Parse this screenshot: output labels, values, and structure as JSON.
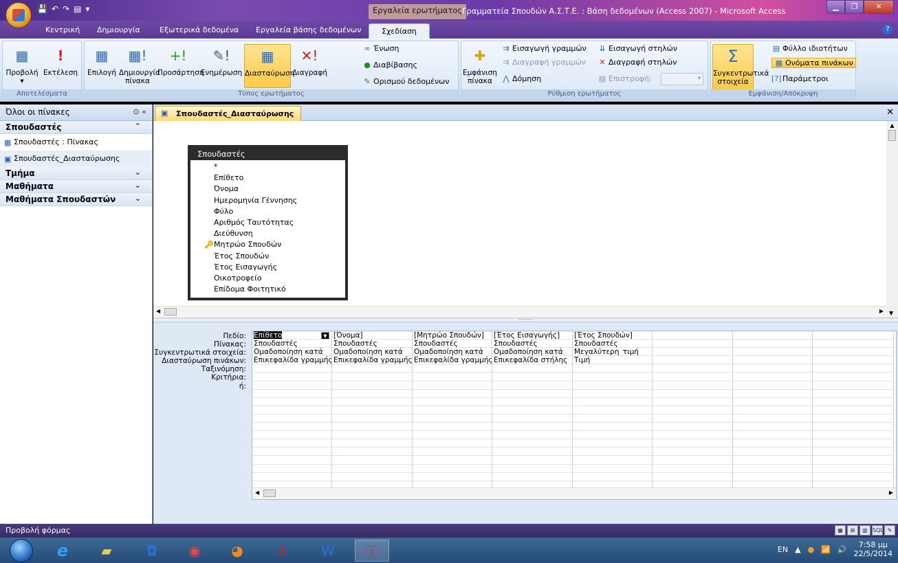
{
  "window": {
    "title": "Γραμματεία Σπουδών Α.Σ.Τ.Ε. : Βάση δεδομένων (Access 2007) - Microsoft Access",
    "context_tab": "Εργαλεία ερωτήματος",
    "qat_icons": [
      "save-icon",
      "undo-icon",
      "redo-icon",
      "view-icon",
      "customize-icon"
    ]
  },
  "tabs": [
    "Κεντρική",
    "Δημιουργία",
    "Εξωτερικά δεδομένα",
    "Εργαλεία βάσης δεδομένων",
    "Σχεδίαση"
  ],
  "ribbon": {
    "results": {
      "caption": "Αποτελέσματα",
      "view": "Προβολή",
      "run": "Εκτέλεση"
    },
    "query_type": {
      "caption": "Τύπος ερωτήματος",
      "select": "Επιλογή",
      "make_table": "Δημιουργία πίνακα",
      "append": "Προσάρτηση",
      "update": "Ενημέρωση",
      "crosstab": "Διασταύρωση",
      "delete": "Διαγραφή",
      "union": "Ένωση",
      "pass_through": "Διαβίβασης",
      "data_definition": "Ορισμού δεδομένων"
    },
    "query_setup": {
      "caption": "Ρύθμιση ερωτήματος",
      "show_table": "Εμφάνιση πίνακα",
      "insert_rows": "Εισαγωγή γραμμών",
      "delete_rows": "Διαγραφή γραμμών",
      "builder": "Δόμηση",
      "insert_columns": "Εισαγωγή στηλών",
      "delete_columns": "Διαγραφή στηλών",
      "return": "Επιστροφή:"
    },
    "show_hide": {
      "caption": "Εμφάνιση/Απόκρυψη",
      "totals": "Συγκεντρωτικά στοιχεία",
      "property_sheet": "Φύλλο ιδιοτήτων",
      "table_names": "Ονόματα πινάκων",
      "parameters": "Παράμετροι"
    }
  },
  "nav": {
    "header": "Όλοι οι πίνακες",
    "groups": [
      {
        "name": "Σπουδαστές",
        "expanded": true,
        "items": [
          {
            "label": "Σπουδαστές : Πίνακας",
            "icon": "table-icon"
          },
          {
            "label": "Σπουδαστές_Διασταύρωσης",
            "icon": "query-icon"
          }
        ]
      },
      {
        "name": "Τμήμα",
        "expanded": false,
        "items": []
      },
      {
        "name": "Μαθήματα",
        "expanded": false,
        "items": []
      },
      {
        "name": "Μαθήματα Σπουδαστών",
        "expanded": false,
        "items": []
      }
    ]
  },
  "document": {
    "tab_title": "Σπουδαστές_Διασταύρωσης",
    "table_box": {
      "name": "Σπουδαστές",
      "fields": [
        "*",
        "Επίθετο",
        "Όνομα",
        "Ημερομηνία Γέννησης",
        "Φύλο",
        "Αριθμός Ταυτότητας",
        "Διεύθυνση",
        "Μητρώο Σπουδών",
        "Έτος Σπουδών",
        "Έτος Εισαγωγής",
        "Οικοτροφείο",
        "Επίδομα Φοιτητικό"
      ],
      "key_field_index": 7
    },
    "grid_row_labels": [
      "Πεδίο:",
      "Πίνακας:",
      "Συγκεντρωτικά στοιχεία:",
      "Διασταύρωση πινάκων:",
      "Ταξινόμηση:",
      "Κριτήρια:",
      "ή:"
    ],
    "grid_columns": [
      {
        "field": "Επίθετο",
        "table": "Σπουδαστές",
        "total": "Ομαδοποίηση κατά",
        "crosstab": "Επικεφαλίδα γραμμής"
      },
      {
        "field": "[Όνομα]",
        "table": "Σπουδαστές",
        "total": "Ομαδοποίηση κατά",
        "crosstab": "Επικεφαλίδα γραμμής"
      },
      {
        "field": "[Μητρώο Σπουδών]",
        "table": "Σπουδαστές",
        "total": "Ομαδοποίηση κατά",
        "crosstab": "Επικεφαλίδα γραμμής"
      },
      {
        "field": "[Έτος Εισαγωγής]",
        "table": "Σπουδαστές",
        "total": "Ομαδοποίηση κατά",
        "crosstab": "Επικεφαλίδα στήλης"
      },
      {
        "field": "[Έτος Σπουδών]",
        "table": "Σπουδαστές",
        "total": "Μεγαλύτερη_τιμή",
        "crosstab": "Τιμή"
      },
      {
        "field": "",
        "table": "",
        "total": "",
        "crosstab": ""
      },
      {
        "field": "",
        "table": "",
        "total": "",
        "crosstab": ""
      },
      {
        "field": "",
        "table": "",
        "total": "",
        "crosstab": ""
      }
    ]
  },
  "status": {
    "text": "Προβολή φόρμας"
  },
  "taskbar": {
    "apps": [
      "ie-icon",
      "explorer-icon",
      "outlook-icon",
      "chrome-icon",
      "firefox-icon",
      "acrobat-icon",
      "word-icon",
      "access-icon"
    ],
    "lang": "EN",
    "time": "7:58 μμ",
    "date": "22/5/2014"
  }
}
